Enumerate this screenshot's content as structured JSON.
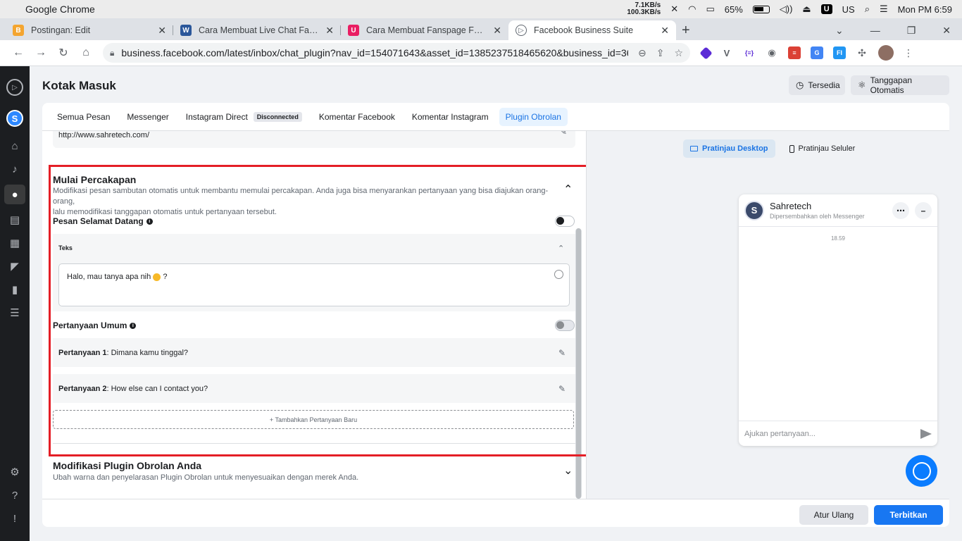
{
  "menubar": {
    "app_name": "Google Chrome",
    "net_up": "7.1KB/s",
    "net_down": "100.3KB/s",
    "battery": "65%",
    "u_badge": "U",
    "input_lang": "US",
    "clock": "Mon PM 6:59"
  },
  "tabs": [
    {
      "label": "Postingan: Edit",
      "fav_color": "#f4a530",
      "fav_text": "B"
    },
    {
      "label": "Cara Membuat Live Chat Faceboo",
      "fav_color": "#2b579a",
      "fav_text": "W"
    },
    {
      "label": "Cara Membuat Fanspage Facebo",
      "fav_color": "#e91e63",
      "fav_text": "U"
    },
    {
      "label": "Facebook Business Suite",
      "fav_color": "#606770",
      "fav_text": "▷"
    }
  ],
  "address": {
    "url": "business.facebook.com/latest/inbox/chat_plugin?nav_id=154071643&asset_id=1385237518465620&business_id=367764..."
  },
  "header": {
    "title": "Kotak Masuk",
    "available_label": "Tersedia",
    "auto_reply_label": "Tanggapan Otomatis"
  },
  "inbox_tabs": [
    {
      "label": "Semua Pesan"
    },
    {
      "label": "Messenger"
    },
    {
      "label": "Instagram Direct",
      "badge": "Disconnected"
    },
    {
      "label": "Komentar Facebook"
    },
    {
      "label": "Komentar Instagram"
    },
    {
      "label": "Plugin Obrolan"
    }
  ],
  "website_url": "http://www.sahretech.com/",
  "start_conversation": {
    "title": "Mulai Percakapan",
    "desc_line1": "Modifikasi pesan sambutan otomatis untuk membantu memulai percakapan. Anda juga bisa menyarankan pertanyaan yang bisa diajukan orang-orang,",
    "desc_line2": "lalu memodifikasi tanggapan otomatis untuk pertanyaan tersebut.",
    "welcome_label": "Pesan Selamat Datang",
    "text_label": "Teks",
    "welcome_text": "Halo, mau tanya apa nih",
    "welcome_suffix": "?",
    "faq_label": "Pertanyaan Umum",
    "questions": [
      {
        "key": "Pertanyaan 1",
        "value": ": Dimana kamu tinggal?"
      },
      {
        "key": "Pertanyaan 2",
        "value": ": How else can I contact you?"
      }
    ],
    "add_question": "+ Tambahkan Pertanyaan Baru"
  },
  "customize": {
    "title": "Modifikasi Plugin Obrolan Anda",
    "desc": "Ubah warna dan penyelarasan Plugin Obrolan untuk menyesuaikan dengan merek Anda."
  },
  "footer": {
    "reset_label": "Atur Ulang",
    "publish_label": "Terbitkan"
  },
  "preview": {
    "desktop_label": "Pratinjau Desktop",
    "mobile_label": "Pratinjau Seluler",
    "page_initial": "S",
    "page_name": "Sahretech",
    "powered_by": "Dipersembahkan oleh Messenger",
    "time": "18.59",
    "input_placeholder": "Ajukan pertanyaan..."
  },
  "account_initial": "S",
  "colors": {
    "accent": "#1b74e4",
    "publish": "#1877f2",
    "highlight_frame": "#e41e26"
  }
}
